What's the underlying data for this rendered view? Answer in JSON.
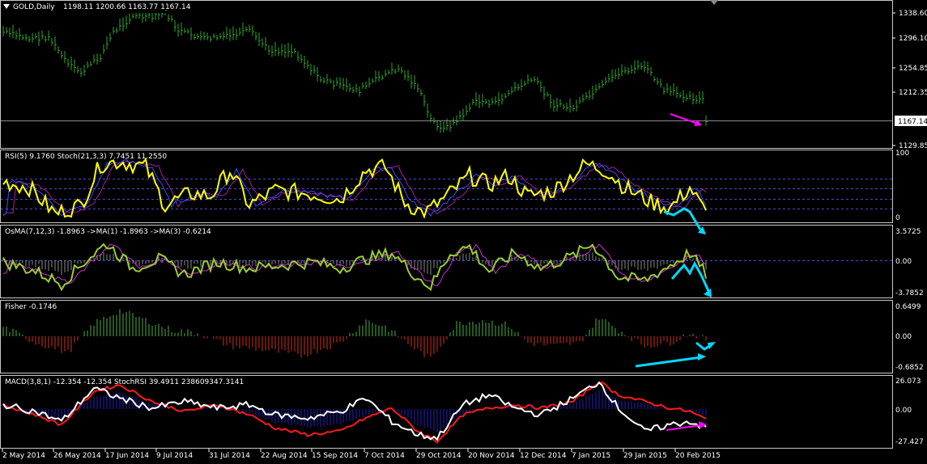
{
  "main": {
    "symbol_label": "GOLD,Daily",
    "ohlc_label": "1198.11 1200.66 1163.77 1167.14",
    "price_levels": [
      "1338.60",
      "1296.10",
      "1254.85",
      "1212.35",
      "1129.85"
    ],
    "current_price": "1167.14",
    "colors": {
      "bars": "#2fa62f",
      "current_line": "#8a8a8a",
      "annotation": "#ff00ff"
    }
  },
  "rsi_panel": {
    "label": "RSI(5) 9.1760  Stoch(21,3,3) 7.7451 11.2550",
    "levels": [
      "100",
      "0"
    ],
    "colors": {
      "rsi": "#ffff00",
      "stoch_main": "#3050ff",
      "stoch_signal": "#a020a0",
      "annotation": "#00d8ff"
    }
  },
  "osma_panel": {
    "label": "OsMA(7,12,3) -1.8963  ->MA(1) -1.8963  ->MA(3) -0.6214",
    "levels": [
      "3.5725",
      "0.00",
      "-3.7852"
    ],
    "colors": {
      "hist": "#8a8a8a",
      "line1": "#9acd32",
      "line2": "#cc33cc",
      "annotation": "#00d8ff"
    }
  },
  "fisher_panel": {
    "label": "Fisher -0.1746",
    "levels": [
      "0.6499",
      "0.00",
      "-0.6852"
    ],
    "colors": {
      "up": "#4caf3f",
      "down": "#d0301b",
      "annotation": "#00d8ff"
    }
  },
  "macd_panel": {
    "label": "MACD(3,8,1) -12.354 -12.354  StochRSI 39.4911 238609347.3141",
    "levels": [
      "26.073",
      "0.00",
      "-27.427"
    ],
    "colors": {
      "hist": "#2020c0",
      "macd": "#ff1a1a",
      "stochrsi": "#ffffff",
      "annotation": "#ff00ff"
    }
  },
  "x_axis": {
    "dates": [
      "2 May 2014",
      "26 May 2014",
      "17 Jun 2014",
      "9 Jul 2014",
      "31 Jul 2014",
      "22 Aug 2014",
      "15 Sep 2014",
      "7 Oct 2014",
      "29 Oct 2014",
      "20 Nov 2014",
      "12 Dec 2014",
      "7 Jan 2015",
      "29 Jan 2015",
      "20 Feb 2015"
    ]
  }
}
